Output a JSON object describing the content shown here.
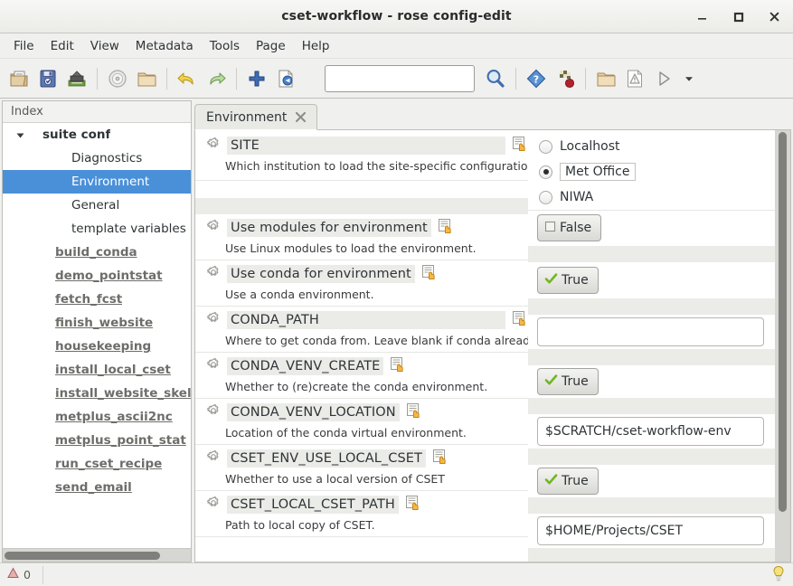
{
  "window": {
    "title": "cset-workflow - rose config-edit",
    "controls": [
      {
        "name": "minimize-button",
        "icon": "minimize-icon"
      },
      {
        "name": "maximize-button",
        "icon": "maximize-icon"
      },
      {
        "name": "close-button",
        "icon": "close-icon"
      }
    ]
  },
  "menubar": {
    "items": [
      "File",
      "Edit",
      "View",
      "Metadata",
      "Tools",
      "Page",
      "Help"
    ]
  },
  "toolbar": {
    "buttons": [
      {
        "name": "open-suite-button",
        "icon": "open-folder-document-icon"
      },
      {
        "name": "save-button",
        "icon": "save-floppy-icon"
      },
      {
        "name": "save-as-button",
        "icon": "save-as-icon"
      },
      {
        "name": "check-button",
        "icon": "disc-icon"
      },
      {
        "name": "browse-button",
        "icon": "folder-icon"
      },
      {
        "name": "undo-button",
        "icon": "undo-arrow-icon"
      },
      {
        "name": "redo-button",
        "icon": "redo-arrow-icon"
      },
      {
        "name": "add-button",
        "icon": "plus-icon"
      },
      {
        "name": "revert-button",
        "icon": "revert-document-icon"
      },
      {
        "name": "find-button",
        "icon": "search-magnifier-icon"
      },
      {
        "name": "help-button",
        "icon": "question-diamond-icon"
      },
      {
        "name": "metadata-button",
        "icon": "checkered-flag-icon"
      },
      {
        "name": "output-button",
        "icon": "folder-icon"
      },
      {
        "name": "validate-button",
        "icon": "warning-document-icon"
      },
      {
        "name": "run-button",
        "icon": "play-triangle-icon"
      },
      {
        "name": "run-menu-button",
        "icon": "chevron-down-icon"
      }
    ],
    "search": {
      "value": "",
      "placeholder": ""
    }
  },
  "sidebar": {
    "header": "Index",
    "items": [
      {
        "label": "suite conf",
        "type": "root",
        "expanded": true,
        "selected": false
      },
      {
        "label": "Diagnostics",
        "type": "child",
        "selected": false
      },
      {
        "label": "Environment",
        "type": "child",
        "selected": true
      },
      {
        "label": "General",
        "type": "child",
        "selected": false
      },
      {
        "label": "template variables",
        "type": "child",
        "selected": false
      },
      {
        "label": "build_conda",
        "type": "link",
        "selected": false
      },
      {
        "label": "demo_pointstat",
        "type": "link",
        "selected": false
      },
      {
        "label": "fetch_fcst",
        "type": "link",
        "selected": false
      },
      {
        "label": "finish_website",
        "type": "link",
        "selected": false
      },
      {
        "label": "housekeeping",
        "type": "link",
        "selected": false
      },
      {
        "label": "install_local_cset",
        "type": "link",
        "selected": false
      },
      {
        "label": "install_website_skelet",
        "type": "link",
        "selected": false
      },
      {
        "label": "metplus_ascii2nc",
        "type": "link",
        "selected": false
      },
      {
        "label": "metplus_point_stat",
        "type": "link",
        "selected": false
      },
      {
        "label": "run_cset_recipe",
        "type": "link",
        "selected": false
      },
      {
        "label": "send_email",
        "type": "link",
        "selected": false
      }
    ]
  },
  "tabs": [
    {
      "label": "Environment",
      "active": true,
      "close_icon": "close-icon"
    }
  ],
  "settings": [
    {
      "name": "SITE",
      "description": "Which institution to load the site-specific configuration for.",
      "widget": "radio",
      "options": [
        "Localhost",
        "Met Office",
        "NIWA"
      ],
      "value": "Met Office"
    },
    {
      "name": "Use modules for environment",
      "description": "Use Linux modules to load the environment.",
      "widget": "boolean",
      "value": "False"
    },
    {
      "name": "Use conda for environment",
      "description": "Use a conda environment.",
      "widget": "boolean",
      "value": "True"
    },
    {
      "name": "CONDA_PATH",
      "description": "Where to get conda from. Leave blank if conda already on path.",
      "widget": "text",
      "value": ""
    },
    {
      "name": "CONDA_VENV_CREATE",
      "description": "Whether to (re)create the conda environment.",
      "widget": "boolean",
      "value": "True"
    },
    {
      "name": "CONDA_VENV_LOCATION",
      "description": "Location of the conda virtual environment.",
      "widget": "text",
      "value": "$SCRATCH/cset-workflow-env"
    },
    {
      "name": "CSET_ENV_USE_LOCAL_CSET",
      "description": "Whether to use a local version of CSET",
      "widget": "boolean",
      "value": "True"
    },
    {
      "name": "CSET_LOCAL_CSET_PATH",
      "description": "Path to local copy of CSET.",
      "widget": "text",
      "value": "$HOME/Projects/CSET"
    }
  ],
  "statusbar": {
    "error_count": "0",
    "error_icon": "warning-icon",
    "hint_icon": "lightbulb-icon"
  },
  "colors": {
    "selection": "#4a90d9",
    "window_bg": "#f0f0ee",
    "panel_bg": "#ffffff",
    "band": "#ebebe8",
    "accent_true": "#73b523",
    "accent_hand": "#f0a020"
  }
}
